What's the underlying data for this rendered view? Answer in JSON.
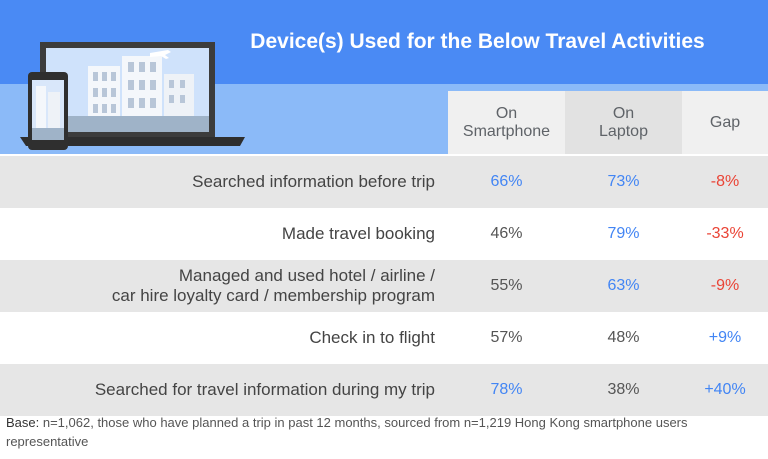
{
  "colors": {
    "blue": "#4285f4",
    "red": "#ea4335",
    "neutral": "#555555"
  },
  "chart_data": {
    "type": "table",
    "title": "Device(s) Used for the Below Travel Activities",
    "columns": [
      {
        "lines": [
          "On",
          "Smartphone"
        ]
      },
      {
        "lines": [
          "On",
          "Laptop"
        ]
      },
      {
        "lines": [
          "Gap"
        ]
      }
    ],
    "rows": [
      {
        "lines": [
          "Searched information before trip"
        ],
        "smartphone": "66%",
        "laptop": "73%",
        "gap": "-8%",
        "colors": [
          "blue",
          "blue",
          "red"
        ]
      },
      {
        "lines": [
          "Made travel booking"
        ],
        "smartphone": "46%",
        "laptop": "79%",
        "gap": "-33%",
        "colors": [
          "neutral",
          "blue",
          "red"
        ]
      },
      {
        "lines": [
          "Managed and used hotel / airline /",
          "car hire loyalty card / membership program"
        ],
        "smartphone": "55%",
        "laptop": "63%",
        "gap": "-9%",
        "colors": [
          "neutral",
          "blue",
          "red"
        ]
      },
      {
        "lines": [
          "Check in to flight"
        ],
        "smartphone": "57%",
        "laptop": "48%",
        "gap": "+9%",
        "colors": [
          "neutral",
          "neutral",
          "blue"
        ]
      },
      {
        "lines": [
          "Searched for travel information during my trip"
        ],
        "smartphone": "78%",
        "laptop": "38%",
        "gap": "+40%",
        "colors": [
          "blue",
          "neutral",
          "blue"
        ]
      }
    ]
  },
  "footnote": {
    "label": "Base:",
    "text": " n=1,062, those who have planned a trip in past 12 months, sourced from n=1,219 Hong Kong smartphone users representative"
  }
}
